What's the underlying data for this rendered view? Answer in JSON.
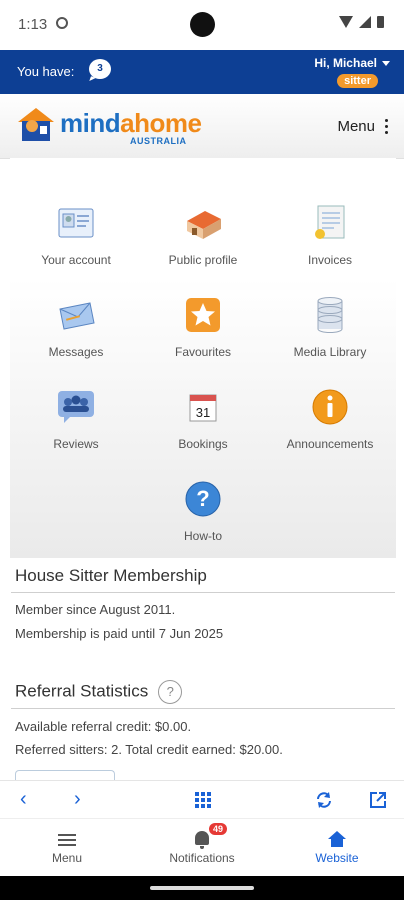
{
  "status_bar": {
    "time": "1:13"
  },
  "topbar": {
    "you_have": "You have:",
    "message_count": "3",
    "greeting": "Hi, Michael",
    "role": "sitter"
  },
  "logo": {
    "mind": "mind",
    "a": "a",
    "home": "home",
    "sub": "AUSTRALIA"
  },
  "header": {
    "menu_label": "Menu"
  },
  "dashboard": {
    "tiles": [
      {
        "label": "Your account",
        "icon": "id-card-icon"
      },
      {
        "label": "Public profile",
        "icon": "house-icon"
      },
      {
        "label": "Invoices",
        "icon": "invoice-icon"
      },
      {
        "label": "Messages",
        "icon": "envelope-icon"
      },
      {
        "label": "Favourites",
        "icon": "star-icon"
      },
      {
        "label": "Media Library",
        "icon": "database-icon"
      },
      {
        "label": "Reviews",
        "icon": "people-icon"
      },
      {
        "label": "Bookings",
        "icon": "calendar-icon"
      },
      {
        "label": "Announcements",
        "icon": "info-icon"
      },
      {
        "label": "How-to",
        "icon": "help-icon"
      }
    ],
    "calendar_day": "31"
  },
  "membership": {
    "title": "House Sitter Membership",
    "since": "Member since August 2011.",
    "paid_until": "Membership is paid until 7 Jun 2025"
  },
  "referral": {
    "title": "Referral Statistics",
    "help": "?",
    "credit": "Available referral credit: $0.00.",
    "referred": "Referred sitters: 2. Total credit earned: $20.00."
  },
  "browser_bar": {
    "back": "‹",
    "forward": "›"
  },
  "bottom_nav": {
    "menu": "Menu",
    "notifications": "Notifications",
    "notifications_badge": "49",
    "website": "Website"
  },
  "colors": {
    "brand_blue": "#0d3f94",
    "accent_orange": "#f39a2c",
    "link_blue": "#1a62d6"
  }
}
